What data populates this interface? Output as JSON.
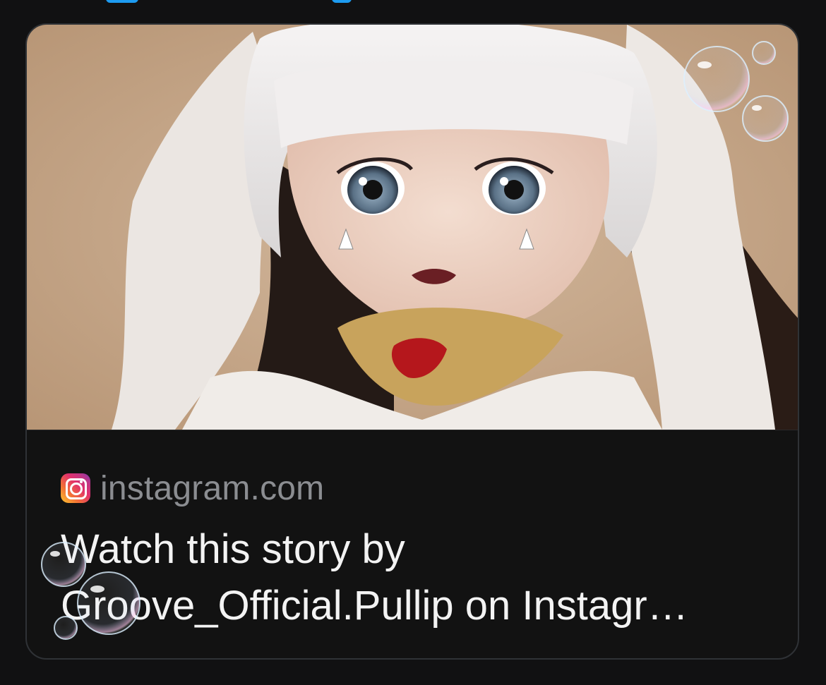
{
  "link_card": {
    "domain": "instagram.com",
    "title": "Watch this story by Groove_Official.Pullip on Instagr…"
  },
  "icons": {
    "site": "instagram-icon"
  }
}
